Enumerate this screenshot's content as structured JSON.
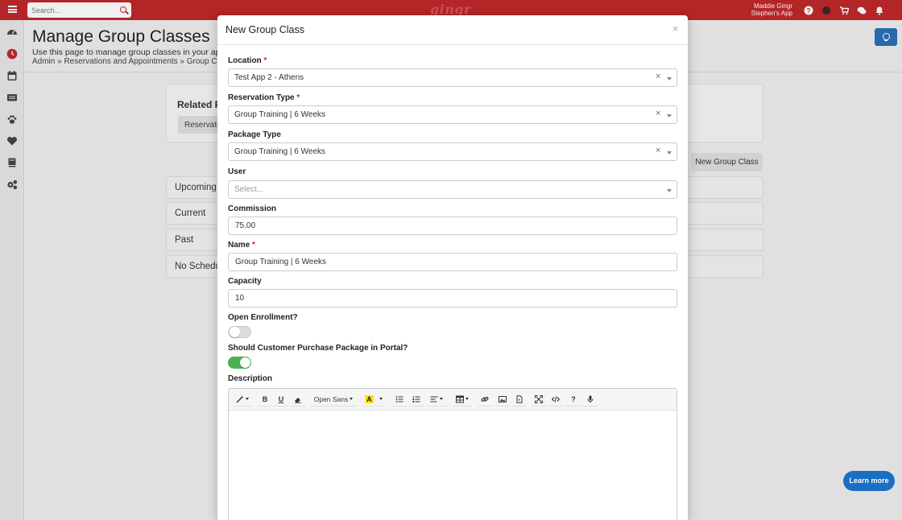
{
  "topbar": {
    "search_placeholder": "Search...",
    "logo": "gingr",
    "user_name": "Maddie Gingr",
    "app_name": "Stephen's App",
    "help_icon_text": "?"
  },
  "page": {
    "title": "Manage Group Classes",
    "subtitle": "Use this page to manage group classes in your app.",
    "breadcrumb": "Admin » Reservations and Appointments » Group Class",
    "related_title": "Related P",
    "related_button": "Reservation",
    "new_class_button": "New Group Class",
    "panels": [
      "Upcoming",
      "Current",
      "Past",
      "No Schedu"
    ]
  },
  "modal": {
    "title": "New Group Class",
    "close": "×",
    "location": {
      "label": "Location",
      "value": "Test App 2 - Athens"
    },
    "reservation_type": {
      "label": "Reservation Type",
      "value": "Group Training | 6 Weeks"
    },
    "package_type": {
      "label": "Package Type",
      "value": "Group Training | 6 Weeks"
    },
    "user": {
      "label": "User",
      "placeholder": "Select..."
    },
    "commission": {
      "label": "Commission",
      "value": "75.00"
    },
    "name": {
      "label": "Name",
      "value": "Group Training | 6 Weeks"
    },
    "capacity": {
      "label": "Capacity",
      "value": "10"
    },
    "open_enrollment": {
      "label": "Open Enrollment?",
      "on": false
    },
    "customer_purchase": {
      "label": "Should Customer Purchase Package in Portal?",
      "on": true
    },
    "description": {
      "label": "Description",
      "font_select": "Open Sans",
      "bold": "B",
      "underline": "U",
      "highlight": "A",
      "help": "?"
    },
    "required_marker": "*",
    "clear_marker": "×"
  },
  "learn_more": "Learn more",
  "colors": {
    "brand_red": "#c0282a",
    "toggle_on": "#4caf50",
    "learn_more_blue": "#1a6fc2"
  }
}
